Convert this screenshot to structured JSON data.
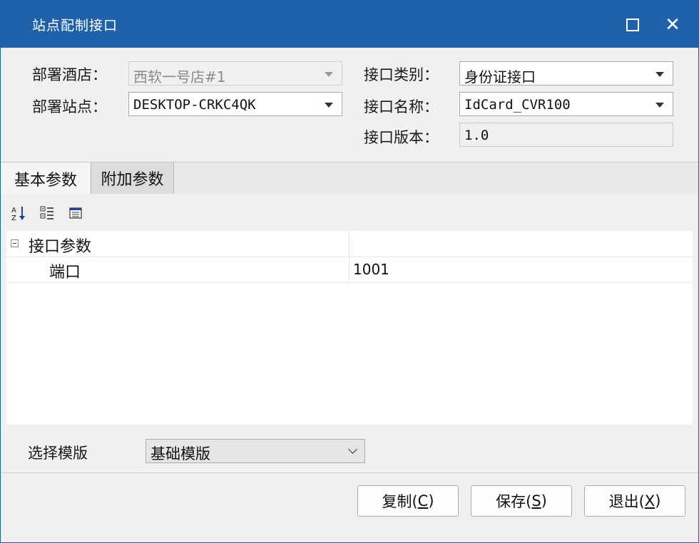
{
  "window": {
    "title": "站点配制接口"
  },
  "form": {
    "hotel_label": "部署酒店：",
    "hotel_value": "西软一号店#1",
    "station_label": "部署站点：",
    "station_value": "DESKTOP-CRKC4QK",
    "iface_type_label": "接口类别：",
    "iface_type_value": "身份证接口",
    "iface_name_label": "接口名称：",
    "iface_name_value": "IdCard_CVR100",
    "iface_version_label": "接口版本：",
    "iface_version_value": "1.0"
  },
  "tabs": [
    {
      "label": "基本参数",
      "active": true
    },
    {
      "label": "附加参数",
      "active": false
    }
  ],
  "toolbar": {
    "icons": [
      "sort-alphabetical-icon",
      "categorized-icon",
      "property-pages-icon"
    ]
  },
  "grid": {
    "category": "接口参数",
    "rows": [
      {
        "name": "端口",
        "value": "1001"
      }
    ]
  },
  "template": {
    "label": "选择模版",
    "value": "基础模版"
  },
  "buttons": {
    "copy_label": "复制(",
    "copy_key": "C",
    "save_label": "保存(",
    "save_key": "S",
    "exit_label": "退出(",
    "exit_key": "X",
    "close_paren": ")"
  },
  "colors": {
    "titlebar": "#1f62a9",
    "window_bg": "#f0f0f0"
  }
}
